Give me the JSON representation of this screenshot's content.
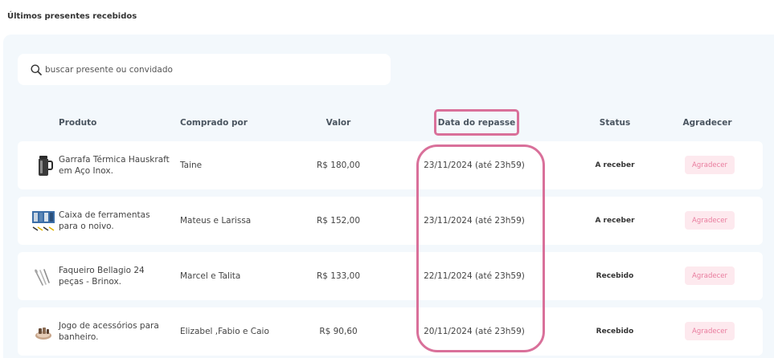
{
  "section_title": "Últimos presentes recebidos",
  "search": {
    "placeholder": "buscar presente ou convidado"
  },
  "table": {
    "headers": {
      "product": "Produto",
      "bought_by": "Comprado por",
      "value": "Valor",
      "transfer_date": "Data do repasse",
      "status": "Status",
      "thank": "Agradecer"
    },
    "rows": [
      {
        "product": "Garrafa Térmica Hauskraft em Aço Inox.",
        "icon": "thermos-bottle-icon",
        "bought_by": "Taine",
        "value": "R$ 180,00",
        "date": "23/11/2024 (até 23h59)",
        "status": "A receber",
        "thank": "Agradecer"
      },
      {
        "product": "Caixa de ferramentas para o noivo.",
        "icon": "toolbox-icon",
        "bought_by": "Mateus e Larissa",
        "value": "R$ 152,00",
        "date": "23/11/2024 (até 23h59)",
        "status": "A receber",
        "thank": "Agradecer"
      },
      {
        "product": "Faqueiro Bellagio 24 peças - Brinox.",
        "icon": "cutlery-icon",
        "bought_by": "Marcel e Talita",
        "value": "R$ 133,00",
        "date": "22/11/2024 (até 23h59)",
        "status": "Recebido",
        "thank": "Agradecer"
      },
      {
        "product": "Jogo de acessórios para banheiro.",
        "icon": "bathroom-accessories-icon",
        "bought_by": "Elizabel ,Fabio e Caio",
        "value": "R$ 90,60",
        "date": "20/11/2024 (até 23h59)",
        "status": "Recebido",
        "thank": "Agradecer"
      }
    ]
  },
  "colors": {
    "highlight": "#d9709a",
    "panel_bg": "#f3f8fc",
    "button_bg": "#fde9ee",
    "button_text": "#e97b9d"
  }
}
